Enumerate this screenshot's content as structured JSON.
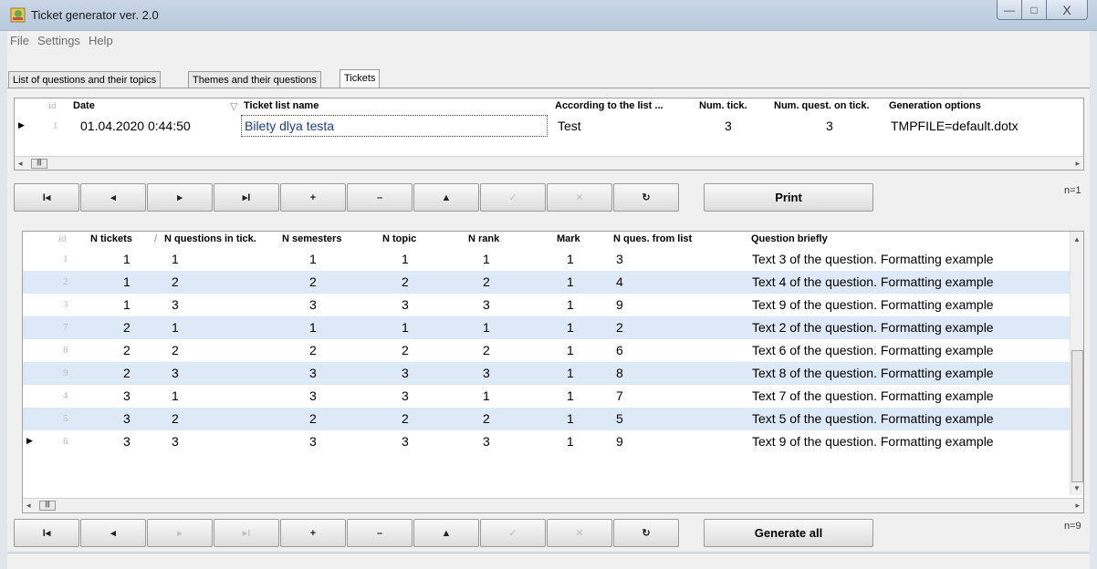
{
  "window": {
    "title": "Ticket generator ver. 2.0",
    "min": "—",
    "max": "□",
    "close": "X"
  },
  "menu": [
    "File",
    "Settings",
    "Help"
  ],
  "tabs": [
    "List of questions and their topics",
    "Themes and their questions",
    "Tickets"
  ],
  "top_grid": {
    "headers": [
      "id",
      "Date",
      "Ticket list name",
      "According to the list ...",
      "Num. tick.",
      "Num. quest. on tick.",
      "Generation options"
    ],
    "rows": [
      {
        "id": "1",
        "date": "01.04.2020 0:44:50",
        "name": "Bilety dlya testa",
        "list": "Test",
        "num_tick": "3",
        "num_quest": "3",
        "options": "TMPFILE=default.dotx"
      }
    ]
  },
  "nav1": {
    "buttons": [
      "first",
      "prior",
      "next",
      "last",
      "insert",
      "delete",
      "edit",
      "post",
      "cancel",
      "refresh"
    ],
    "print_label": "Print",
    "count": "n=1"
  },
  "bottom_grid": {
    "headers": [
      "id",
      "N tickets",
      "N questions in tick.",
      "N semesters",
      "N topic",
      "N rank",
      "Mark",
      "N ques. from list",
      "Question briefly"
    ],
    "rows": [
      {
        "id": "1",
        "nt": "1",
        "nq": "1",
        "ns": "1",
        "ntop": "1",
        "nr": "1",
        "mark": "1",
        "nql": "3",
        "text": "Text 3 of the question. Formatting example"
      },
      {
        "id": "2",
        "nt": "1",
        "nq": "2",
        "ns": "2",
        "ntop": "2",
        "nr": "2",
        "mark": "1",
        "nql": "4",
        "text": "Text 4 of the question. Formatting example"
      },
      {
        "id": "3",
        "nt": "1",
        "nq": "3",
        "ns": "3",
        "ntop": "3",
        "nr": "3",
        "mark": "1",
        "nql": "9",
        "text": "Text 9 of the question. Formatting example"
      },
      {
        "id": "7",
        "nt": "2",
        "nq": "1",
        "ns": "1",
        "ntop": "1",
        "nr": "1",
        "mark": "1",
        "nql": "2",
        "text": "Text 2 of the question. Formatting example"
      },
      {
        "id": "8",
        "nt": "2",
        "nq": "2",
        "ns": "2",
        "ntop": "2",
        "nr": "2",
        "mark": "1",
        "nql": "6",
        "text": "Text 6 of the question. Formatting example"
      },
      {
        "id": "9",
        "nt": "2",
        "nq": "3",
        "ns": "3",
        "ntop": "3",
        "nr": "3",
        "mark": "1",
        "nql": "8",
        "text": "Text 8 of the question. Formatting example"
      },
      {
        "id": "4",
        "nt": "3",
        "nq": "1",
        "ns": "3",
        "ntop": "3",
        "nr": "1",
        "mark": "1",
        "nql": "7",
        "text": "Text 7 of the question. Formatting example"
      },
      {
        "id": "5",
        "nt": "3",
        "nq": "2",
        "ns": "2",
        "ntop": "2",
        "nr": "2",
        "mark": "1",
        "nql": "5",
        "text": "Text 5 of the question. Formatting example"
      },
      {
        "id": "6",
        "nt": "3",
        "nq": "3",
        "ns": "3",
        "ntop": "3",
        "nr": "3",
        "mark": "1",
        "nql": "9",
        "text": "Text 9 of the question. Formatting example"
      }
    ]
  },
  "nav2": {
    "generate_label": "Generate all",
    "count": "n=9"
  },
  "glyphs": {
    "first": "I◂",
    "prior": "◂",
    "next": "▸",
    "last": "▸I",
    "insert": "+",
    "delete": "–",
    "edit": "▲",
    "post": "✓",
    "cancel": "✕",
    "refresh": "↻",
    "sort": "▽",
    "sort2": "/"
  },
  "colors": {
    "selected_row": "#dde9f7",
    "name_text": "#1b3c8f"
  }
}
